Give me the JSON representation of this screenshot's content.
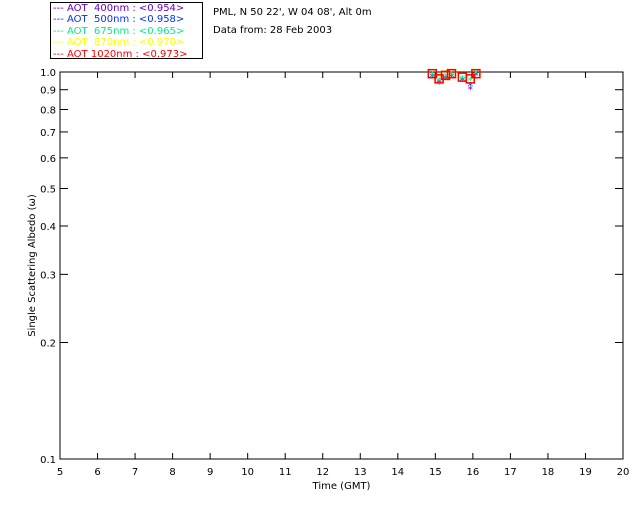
{
  "header": {
    "location": "PML, N 50 22', W 04 08', Alt 0m",
    "date": "Data from: 28 Feb 2003"
  },
  "chart_data": {
    "type": "scatter",
    "xlabel": "Time (GMT)",
    "ylabel": "Single Scattering Albedo (ω)",
    "xlim": [
      5,
      20
    ],
    "ylim": [
      0.1,
      1.0
    ],
    "yscale": "log",
    "grid": false,
    "legend_placement": "top-left, outside",
    "xticks": [
      "5",
      "6",
      "7",
      "8",
      "9",
      "10",
      "11",
      "12",
      "13",
      "14",
      "15",
      "16",
      "17",
      "18",
      "19",
      "20"
    ],
    "yticks": [
      "0.1",
      "0.2",
      "0.3",
      "0.4",
      "0.5",
      "0.6",
      "0.7",
      "0.8",
      "0.9",
      "1.0"
    ],
    "x": [
      14.92,
      15.1,
      15.27,
      15.43,
      15.72,
      15.93,
      16.08
    ],
    "series": [
      {
        "name": "AOT  400nm : <0.954>",
        "color": "#6600cc",
        "values": [
          0.97,
          0.93,
          0.96,
          0.97,
          0.95,
          0.9,
          0.98
        ]
      },
      {
        "name": "AOT  500nm : <0.958>",
        "color": "#0033ff",
        "values": [
          0.97,
          0.94,
          0.96,
          0.97,
          0.95,
          0.92,
          0.98
        ]
      },
      {
        "name": "AOT  675nm : <0.965>",
        "color": "#00ee88",
        "values": [
          0.98,
          0.95,
          0.97,
          0.98,
          0.96,
          0.95,
          0.99
        ]
      },
      {
        "name": "AOT  870nm : <0.970>",
        "color": "#ffff00",
        "values": [
          0.99,
          0.96,
          0.98,
          0.99,
          0.97,
          0.96,
          0.99
        ]
      },
      {
        "name": "AOT 1020nm : <0.973>",
        "color": "#ff0000",
        "values": [
          0.99,
          0.96,
          0.98,
          0.99,
          0.97,
          0.96,
          0.99
        ]
      }
    ]
  }
}
